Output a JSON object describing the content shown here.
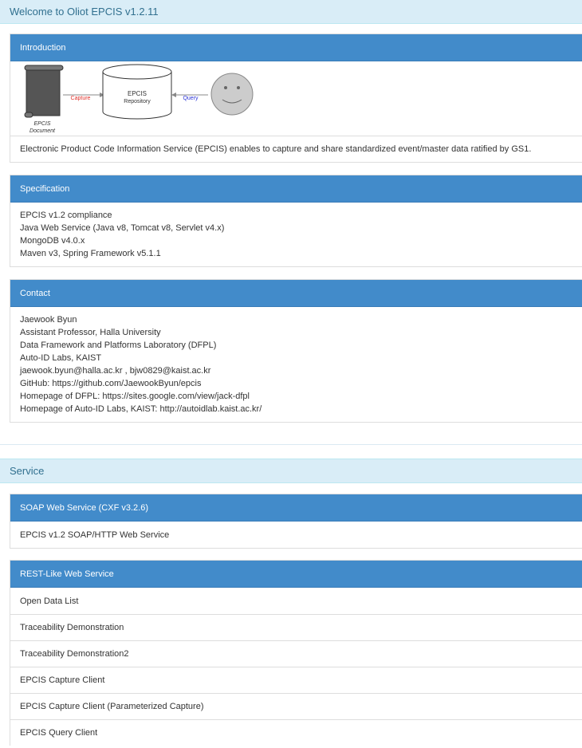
{
  "welcome": {
    "title": "Welcome to Oliot EPCIS v1.2.11"
  },
  "introduction": {
    "heading": "Introduction",
    "diagram": {
      "document_label_1": "EPCIS",
      "document_label_2": "Document",
      "capture_label": "Capture",
      "repo_label_1": "EPCIS",
      "repo_label_2": "Repository",
      "query_label": "Query",
      "capture_color": "#e0302a",
      "query_color": "#2a33d6"
    },
    "text": "Electronic Product Code Information Service (EPCIS) enables to capture and share standardized event/master data ratified by GS1."
  },
  "specification": {
    "heading": "Specification",
    "lines": [
      "EPCIS v1.2 compliance",
      "Java Web Service (Java v8, Tomcat v8, Servlet v4.x)",
      "MongoDB v4.0.x",
      "Maven v3, Spring Framework v5.1.1"
    ]
  },
  "contact": {
    "heading": "Contact",
    "lines": [
      "Jaewook Byun",
      "Assistant Professor, Halla University",
      "Data Framework and Platforms Laboratory (DFPL)",
      "Auto-ID Labs, KAIST",
      "jaewook.byun@halla.ac.kr , bjw0829@kaist.ac.kr",
      "GitHub: https://github.com/JaewookByun/epcis",
      "Homepage of DFPL: https://sites.google.com/view/jack-dfpl",
      "Homepage of Auto-ID Labs, KAIST: http://autoidlab.kaist.ac.kr/"
    ]
  },
  "service": {
    "title": "Service",
    "soap": {
      "heading": "SOAP Web Service (CXF v3.2.6)",
      "items": [
        "EPCIS v1.2 SOAP/HTTP Web Service"
      ]
    },
    "rest": {
      "heading": "REST-Like Web Service",
      "items": [
        "Open Data List",
        "Traceability Demonstration",
        "Traceability Demonstration2",
        "EPCIS Capture Client",
        "EPCIS Capture Client (Parameterized Capture)",
        "EPCIS Query Client"
      ]
    }
  },
  "colors": {
    "panel_heading": "#428bca",
    "section_bg": "#d9edf7",
    "section_text": "#31708f"
  }
}
